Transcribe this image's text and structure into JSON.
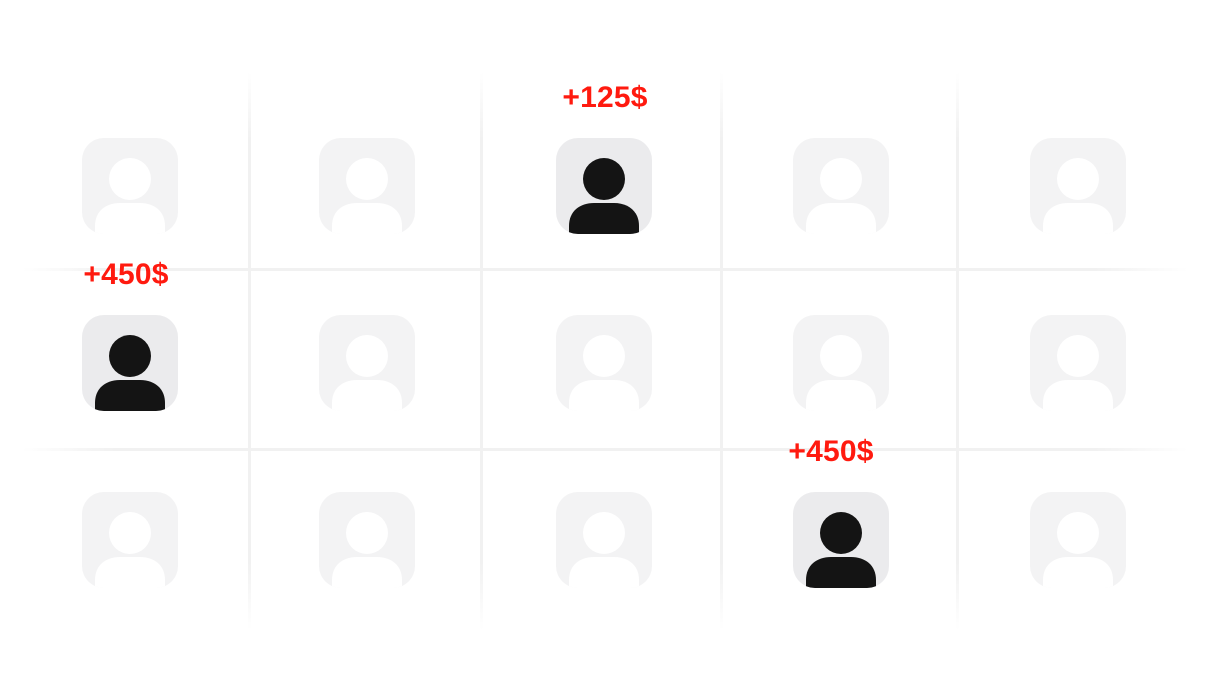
{
  "grid": {
    "rows": [
      [
        {
          "active": false,
          "bonus": ""
        },
        {
          "active": false,
          "bonus": ""
        },
        {
          "active": true,
          "bonus": "+125$"
        },
        {
          "active": false,
          "bonus": ""
        },
        {
          "active": false,
          "bonus": ""
        }
      ],
      [
        {
          "active": true,
          "bonus": "+450$"
        },
        {
          "active": false,
          "bonus": ""
        },
        {
          "active": false,
          "bonus": ""
        },
        {
          "active": false,
          "bonus": ""
        },
        {
          "active": false,
          "bonus": ""
        }
      ],
      [
        {
          "active": false,
          "bonus": ""
        },
        {
          "active": false,
          "bonus": ""
        },
        {
          "active": false,
          "bonus": ""
        },
        {
          "active": true,
          "bonus": "+450$"
        },
        {
          "active": false,
          "bonus": ""
        }
      ]
    ]
  },
  "icon": "user-avatar-icon",
  "colors": {
    "bonus_text": "#ff1a0f",
    "active_figure": "#141414",
    "active_tile": "#ebebed",
    "inactive_tile": "#f3f3f4",
    "grid_line": "#f1f1f1"
  }
}
